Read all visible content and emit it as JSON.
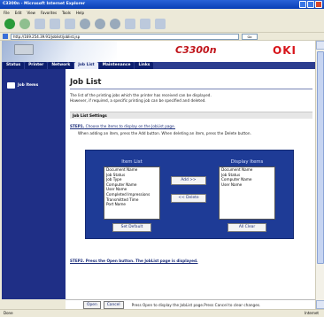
{
  "window": {
    "title": "C3300n - Microsoft Internet Explorer"
  },
  "menu": {
    "items": [
      "File",
      "Edit",
      "View",
      "Favorites",
      "Tools",
      "Help"
    ]
  },
  "address": {
    "value": "http://169.254.39.91/joblist/joblist.jsp",
    "go_label": "Go"
  },
  "banner": {
    "brand": "C3300n",
    "logo": "OKI"
  },
  "tabs": [
    "Status",
    "Printer",
    "Network",
    "Job List",
    "Maintenance",
    "Links"
  ],
  "sidebar": {
    "item": "Job Items"
  },
  "page": {
    "title": "Job List",
    "desc_line1": "The list of the printing jobs which the printer has received can be displayed.",
    "desc_line2": "However, if required, a specific printing job can be specified and deleted.",
    "settings": "Job List Settings",
    "step1_label": "STEP1.",
    "step1_text": " Choose the items to display on the JobList page.",
    "step1_sub": "When adding an item, press the Add button. When deleting an item, press the Delete button.",
    "item_list_title": "Item List",
    "display_items_title": "Display Items",
    "item_list": [
      "Document Name",
      "Job Status",
      "Job Type",
      "Computer Name",
      "User Name",
      "Completed Impressions",
      "Transmitted Time",
      "Port Name"
    ],
    "display_items": [
      "Document Name",
      "Job Status",
      "Computer Name",
      "User Name"
    ],
    "add_label": "Add >>",
    "delete_label": "<< Delete",
    "set_default_label": "Set Default",
    "all_clear_label": "All Clear",
    "step2": "STEP2. Press the Open button. The JobList page is displayed."
  },
  "bottom": {
    "open_label": "Open",
    "cancel_label": "Cancel",
    "hint": "Press Open to display the JobList page.Press Cancel to clear changes."
  },
  "status": {
    "left": "Done",
    "right": "Internet"
  }
}
